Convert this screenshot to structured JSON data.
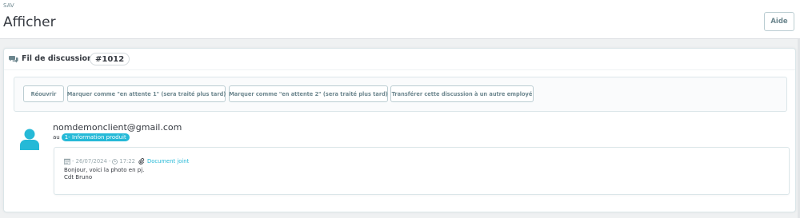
{
  "header": {
    "breadcrumb": "SAV",
    "title": "Afficher",
    "help_label": "Aide"
  },
  "panel": {
    "heading_label": "Fil de discussion:",
    "thread_number": "#1012",
    "actions": [
      {
        "label": "Réouvrir"
      },
      {
        "label": "Marquer comme \"en attente 1\" (sera traité plus tard)"
      },
      {
        "label": "Marquer comme \"en attente 2\" (sera traité plus tard)"
      },
      {
        "label": "Transférer cette discussion à un autre employé"
      }
    ]
  },
  "message": {
    "sender_email": "nomdemonclient@gmail.com",
    "contact_prefix": "au",
    "contact_badge": "1- Information produit",
    "date": "- 26/07/2024 -",
    "time": "17:22",
    "attachment": "Document joint",
    "body_lines": [
      "Bonjour, voici la photo en pj.",
      "Cdt Bruno"
    ]
  },
  "colors": {
    "accent": "#25b9d7",
    "text": "#363a41",
    "muted": "#6c868e",
    "border": "#bbcdd2"
  },
  "icons": [
    "comments-icon",
    "user-icon",
    "calendar-icon",
    "clock-icon",
    "paperclip-icon"
  ]
}
